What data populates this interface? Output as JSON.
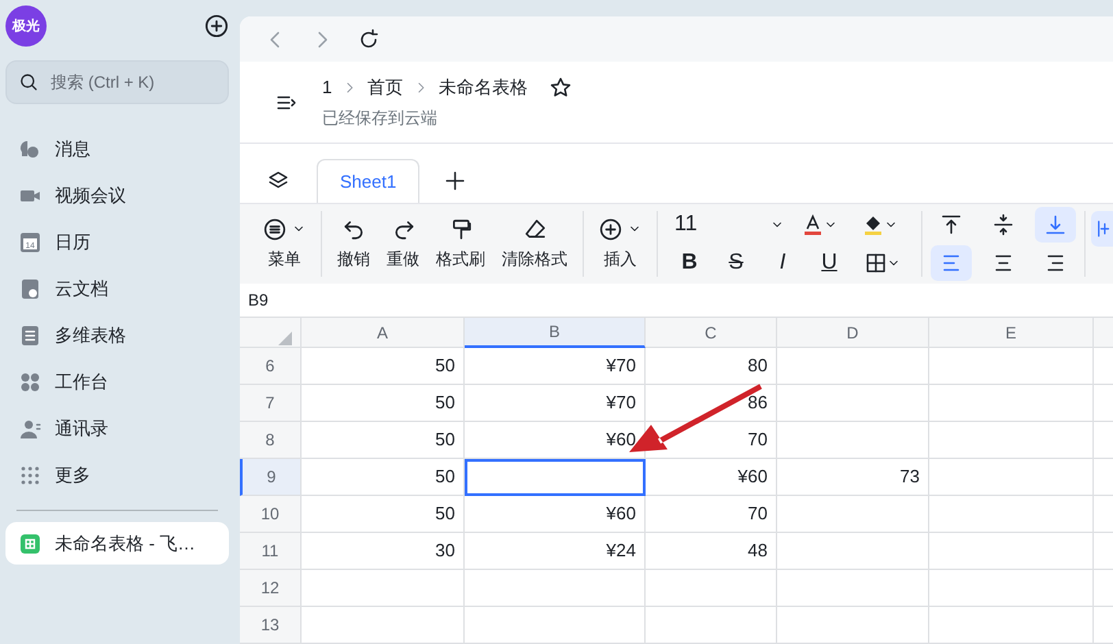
{
  "user": {
    "avatar": "极光"
  },
  "search": {
    "placeholder": "搜索 (Ctrl + K)"
  },
  "sidebar": {
    "items": [
      {
        "label": "消息"
      },
      {
        "label": "视频会议"
      },
      {
        "label": "日历",
        "icon_text": "14"
      },
      {
        "label": "云文档"
      },
      {
        "label": "多维表格"
      },
      {
        "label": "工作台"
      },
      {
        "label": "通讯录"
      },
      {
        "label": "更多"
      }
    ],
    "open_docs": [
      {
        "label": "未命名表格 - 飞…",
        "selected": true
      }
    ]
  },
  "breadcrumb": [
    "1",
    "首页",
    "未命名表格"
  ],
  "save_status": "已经保存到云端",
  "sheet_tabs": [
    {
      "label": "Sheet1",
      "selected": true
    }
  ],
  "toolbar": {
    "groups": [
      [
        {
          "label": "菜单",
          "dropdown": true
        }
      ],
      [
        {
          "label": "撤销",
          "dropdown": false
        },
        {
          "label": "重做",
          "dropdown": false
        },
        {
          "label": "格式刷",
          "dropdown": false
        },
        {
          "label": "清除格式",
          "dropdown": false
        }
      ],
      [
        {
          "label": "插入",
          "dropdown": true
        }
      ]
    ],
    "font_size": "11",
    "format_glyphs": [
      "B",
      "S",
      "I",
      "U"
    ],
    "vertical_align": [
      {
        "selected": false
      },
      {
        "selected": false
      },
      {
        "selected": true
      }
    ],
    "horizontal_align": [
      {
        "selected": true
      },
      {
        "selected": false
      },
      {
        "selected": false
      }
    ]
  },
  "cell_ref": "B9",
  "table": {
    "columns": [
      {
        "label": "A",
        "selected": false
      },
      {
        "label": "B",
        "selected": true
      },
      {
        "label": "C",
        "selected": false
      },
      {
        "label": "D",
        "selected": false
      },
      {
        "label": "E",
        "selected": false
      }
    ],
    "rows": [
      {
        "number": "6",
        "cells": [
          "50",
          "¥70",
          "80",
          "",
          ""
        ],
        "selected": false
      },
      {
        "number": "7",
        "cells": [
          "50",
          "¥70",
          "86",
          "",
          ""
        ],
        "selected": false
      },
      {
        "number": "8",
        "cells": [
          "50",
          "¥60",
          "70",
          "",
          ""
        ],
        "selected": false
      },
      {
        "number": "9",
        "cells": [
          "50",
          "",
          "¥60",
          "73",
          ""
        ],
        "selected": true
      },
      {
        "number": "10",
        "cells": [
          "50",
          "¥60",
          "70",
          "",
          ""
        ],
        "selected": false
      },
      {
        "number": "11",
        "cells": [
          "30",
          "¥24",
          "48",
          "",
          ""
        ],
        "selected": false
      },
      {
        "number": "12",
        "cells": [
          "",
          "",
          "",
          "",
          ""
        ],
        "selected": false
      },
      {
        "number": "13",
        "cells": [
          "",
          "",
          "",
          "",
          ""
        ],
        "selected": false
      }
    ]
  }
}
